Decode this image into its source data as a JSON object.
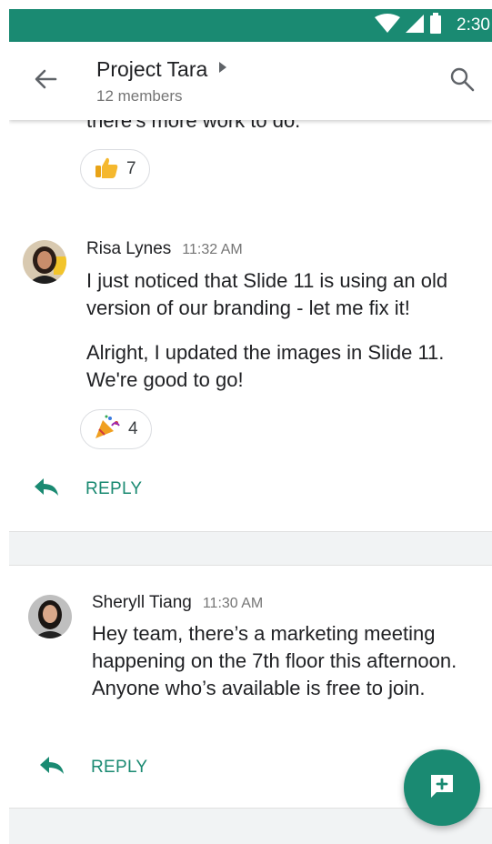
{
  "status_bar": {
    "time": "2:30",
    "icons": [
      "wifi-icon",
      "signal-icon",
      "battery-icon"
    ],
    "color": "#1a8a72"
  },
  "app_bar": {
    "title": "Project Tara",
    "subtitle": "12 members",
    "icons": [
      "back-arrow-icon",
      "caret-right-icon",
      "search-icon"
    ]
  },
  "thread1": {
    "cut_text": "there's more work to do.",
    "reaction": {
      "emoji": "thumbs-up",
      "count": "7"
    }
  },
  "thread2": {
    "sender": "Risa Lynes",
    "time": "11:32 AM",
    "messages": [
      "I just noticed that Slide 11 is using an old version of our branding - let me fix it!",
      "Alright, I updated the images in Slide 11. We're good to go!"
    ],
    "reaction": {
      "emoji": "party-popper",
      "count": "4"
    },
    "reply_label": "REPLY"
  },
  "thread3": {
    "sender": "Sheryll Tiang",
    "time": "11:30 AM",
    "message": "Hey team, there’s a marketing meeting happening on the 7th floor this afternoon. Anyone who’s available is free to join.",
    "reply_label": "REPLY"
  },
  "fab": {
    "icon": "new-message-icon"
  },
  "colors": {
    "accent": "#1a8a72",
    "text": "#202124",
    "secondary": "#757575",
    "band": "#f1f3f4"
  }
}
